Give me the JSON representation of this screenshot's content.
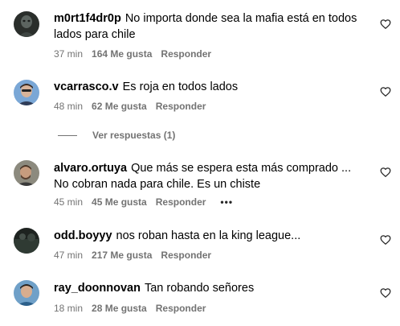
{
  "comments": [
    {
      "username": "m0rt1f4dr0p",
      "text": "No importa donde sea la mafia está en todos lados para chile",
      "time": "37 min",
      "likes": "164 Me gusta",
      "reply": "Responder"
    },
    {
      "username": "vcarrasco.v",
      "text": "Es roja en todos lados",
      "time": "48 min",
      "likes": "62 Me gusta",
      "reply": "Responder",
      "view_replies": "Ver respuestas (1)"
    },
    {
      "username": "alvaro.ortuya",
      "text": "Que más se espera esta más comprado ... No cobran nada para chile. Es un chiste",
      "time": "45 min",
      "likes": "45 Me gusta",
      "reply": "Responder",
      "more": "•••"
    },
    {
      "username": "odd.boyyy",
      "text": "nos roban hasta en la king league...",
      "time": "47 min",
      "likes": "217 Me gusta",
      "reply": "Responder"
    },
    {
      "username": "ray_doonnovan",
      "text": "Tan robando señores",
      "time": "18 min",
      "likes": "28 Me gusta",
      "reply": "Responder"
    }
  ],
  "icons": {
    "like": "heart-outline-icon",
    "more": "more-options-icon"
  },
  "colors": {
    "text": "#000000",
    "secondary": "#737373",
    "background": "#ffffff"
  }
}
